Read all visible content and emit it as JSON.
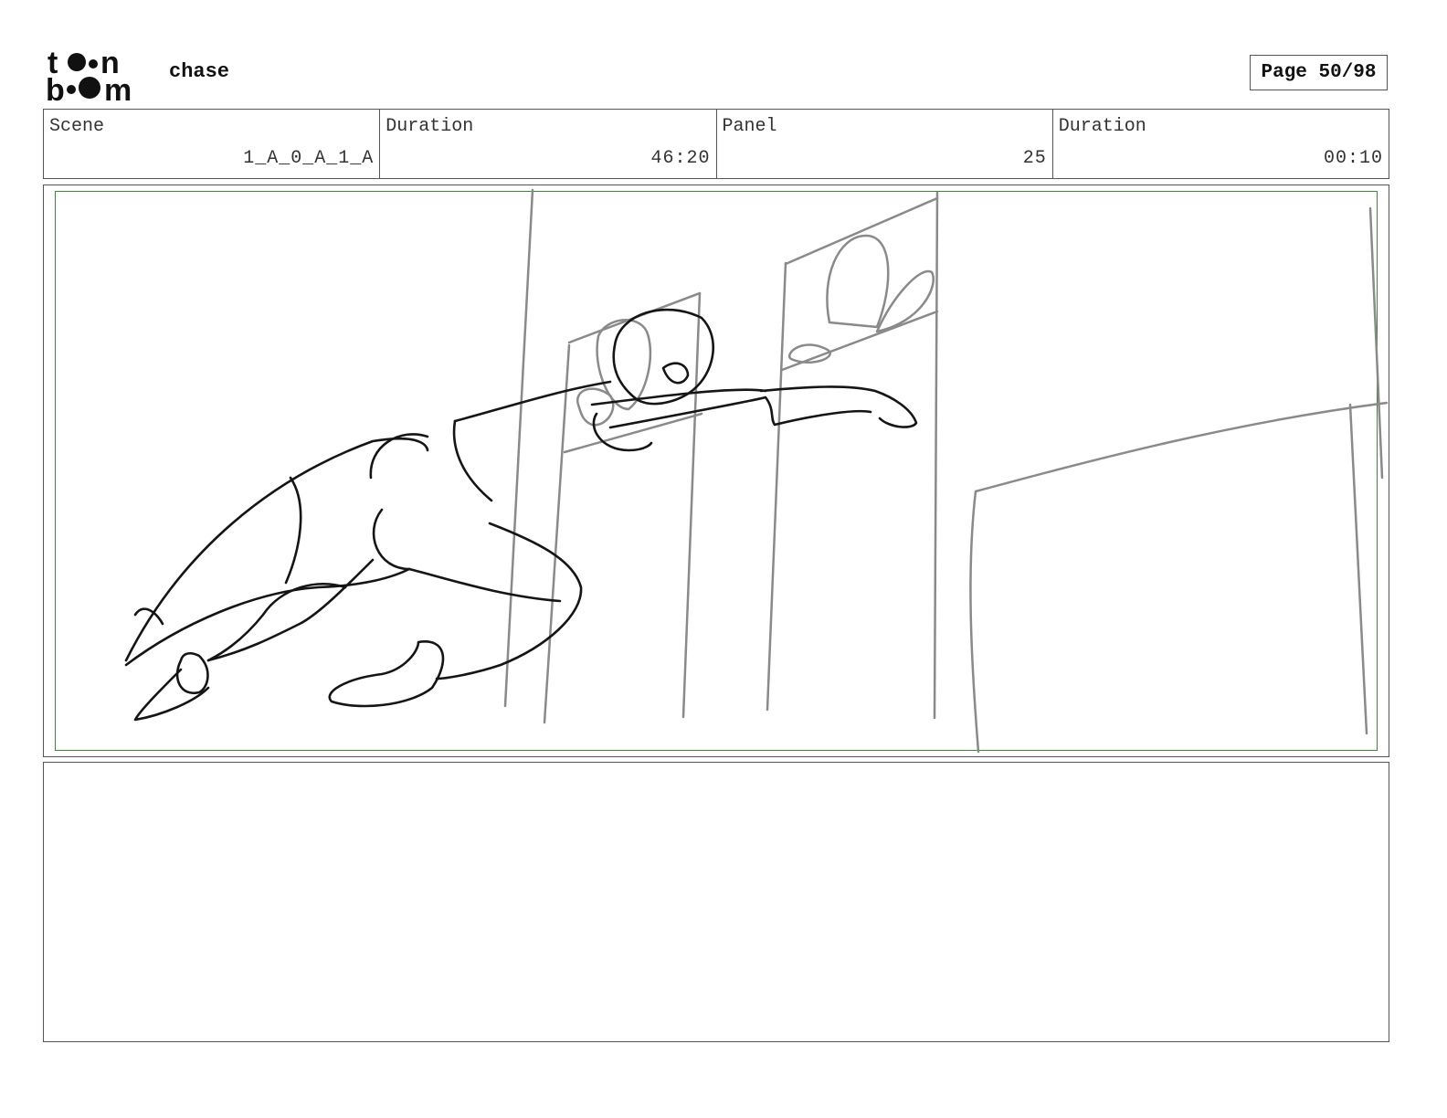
{
  "header": {
    "logo": {
      "text_top": "toon",
      "text_bottom": "boom",
      "icon": "toonboom-logo"
    },
    "project_title": "chase",
    "page_indicator": "Page 50/98"
  },
  "info_bar": {
    "scene": {
      "label": "Scene",
      "value": "1_A_0_A_1_A"
    },
    "scene_duration": {
      "label": "Duration",
      "value": "46:20"
    },
    "panel": {
      "label": "Panel",
      "value": "25"
    },
    "panel_duration": {
      "label": "Duration",
      "value": "00:10"
    }
  },
  "panel": {
    "safe_frame_color": "#3a8a3a",
    "sketch_ink": "#111111",
    "sketch_construction": "#8a8a8a"
  },
  "notes": {
    "text": ""
  }
}
